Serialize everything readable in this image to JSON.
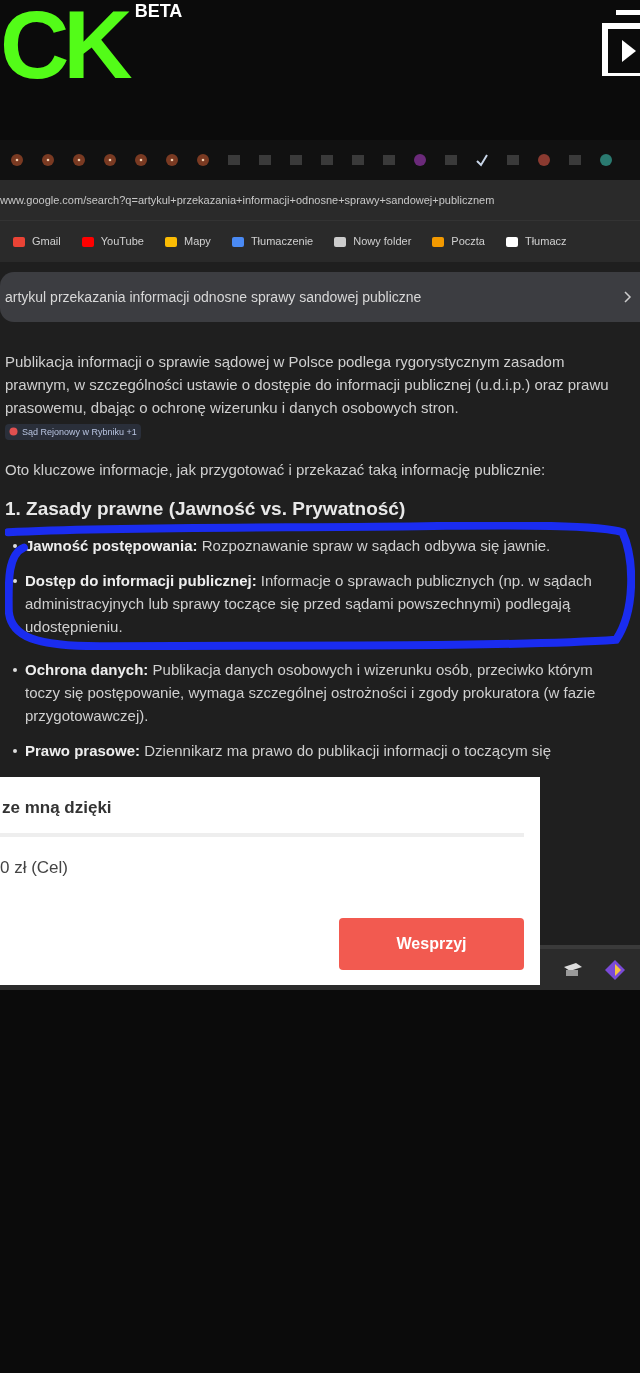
{
  "logo": {
    "text": "CK",
    "badge": "BETA"
  },
  "address_bar": {
    "url": "www.google.com/search?q=artykul+przekazania+informacji+odnosne+sprawy+sandowej+publicznem"
  },
  "bookmarks": [
    {
      "label": "Gmail"
    },
    {
      "label": "YouTube"
    },
    {
      "label": "Mapy"
    },
    {
      "label": "Tłumaczenie"
    },
    {
      "label": "Nowy folder"
    },
    {
      "label": "Poczta"
    },
    {
      "label": "Tłumacz"
    }
  ],
  "search": {
    "value": "artykul przekazania informacji odnosne sprawy sandowej publiczne"
  },
  "overview": {
    "paragraph": "Publikacja informacji o sprawie sądowej w Polsce podlega rygorystycznym zasadom prawnym, w szczególności ustawie o dostępie do informacji publicznej (u.d.i.p.) oraz prawu prasowemu, dbając o ochronę wizerunku i danych osobowych stron.",
    "source_chip": "Sąd Rejonowy w Rybniku +1",
    "intro": "Oto kluczowe informacje, jak przygotować i przekazać taką informację publicznie:",
    "heading": "1. Zasady prawne (Jawność vs. Prywatność)",
    "bullets": [
      {
        "term": "Jawność postępowania:",
        "text": "Rozpoznawanie spraw w sądach odbywa się jawnie."
      },
      {
        "term": "Dostęp do informacji publicznej:",
        "text": "Informacje o sprawach publicznych (np. w sądach administracyjnych lub sprawy toczące się przed sądami powszechnymi) podlegają udostępnieniu."
      },
      {
        "term": "Ochrona danych:",
        "text": "Publikacja danych osobowych i wizerunku osób, przeciwko którym toczy się postępowanie, wymaga szczególnej ostrożności i zgody prokuratora (w fazie przygotowawczej)."
      },
      {
        "term": "Prawo prasowe:",
        "text": "Dziennikarz ma prawo do publikacji informacji o toczącym się"
      }
    ]
  },
  "donation_popup": {
    "title": "ze mną dzięki",
    "amount": "0 zł (Cel)",
    "button": "Wesprzyj"
  }
}
